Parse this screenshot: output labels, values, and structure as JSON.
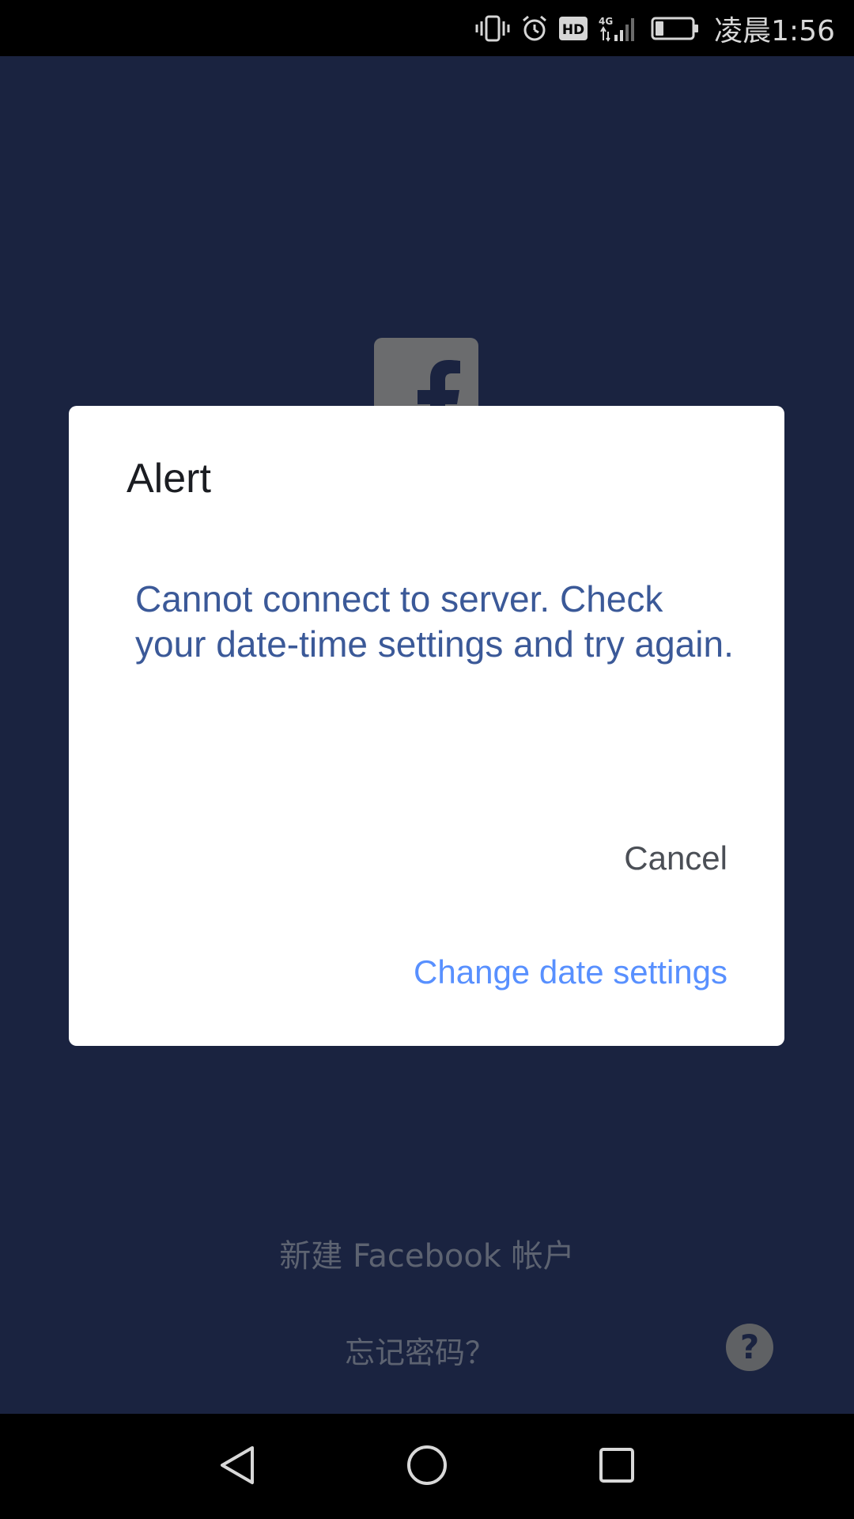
{
  "status_bar": {
    "time": "凌晨1:56",
    "icons": [
      "vibrate-icon",
      "alarm-icon",
      "hd-icon",
      "4g-signal-icon",
      "battery-icon"
    ],
    "hd_label": "HD",
    "network_label": "4G"
  },
  "background_screen": {
    "logo_icon": "facebook-logo-icon",
    "create_account": "新建 Facebook 帐户",
    "forgot_password": "忘记密码？",
    "help_icon_label": "?"
  },
  "dialog": {
    "title": "Alert",
    "message": "Cannot connect to server. Check your date-time settings and try again.",
    "cancel_label": "Cancel",
    "change_date_label": "Change date settings"
  },
  "nav_bar": {
    "icons": [
      "back-icon",
      "home-icon",
      "recents-icon"
    ]
  },
  "colors": {
    "background": "#1a2340",
    "dialog_message": "#3b5998",
    "dialog_action_primary": "#5890ff",
    "dialog_action_secondary": "#4b4f56"
  }
}
